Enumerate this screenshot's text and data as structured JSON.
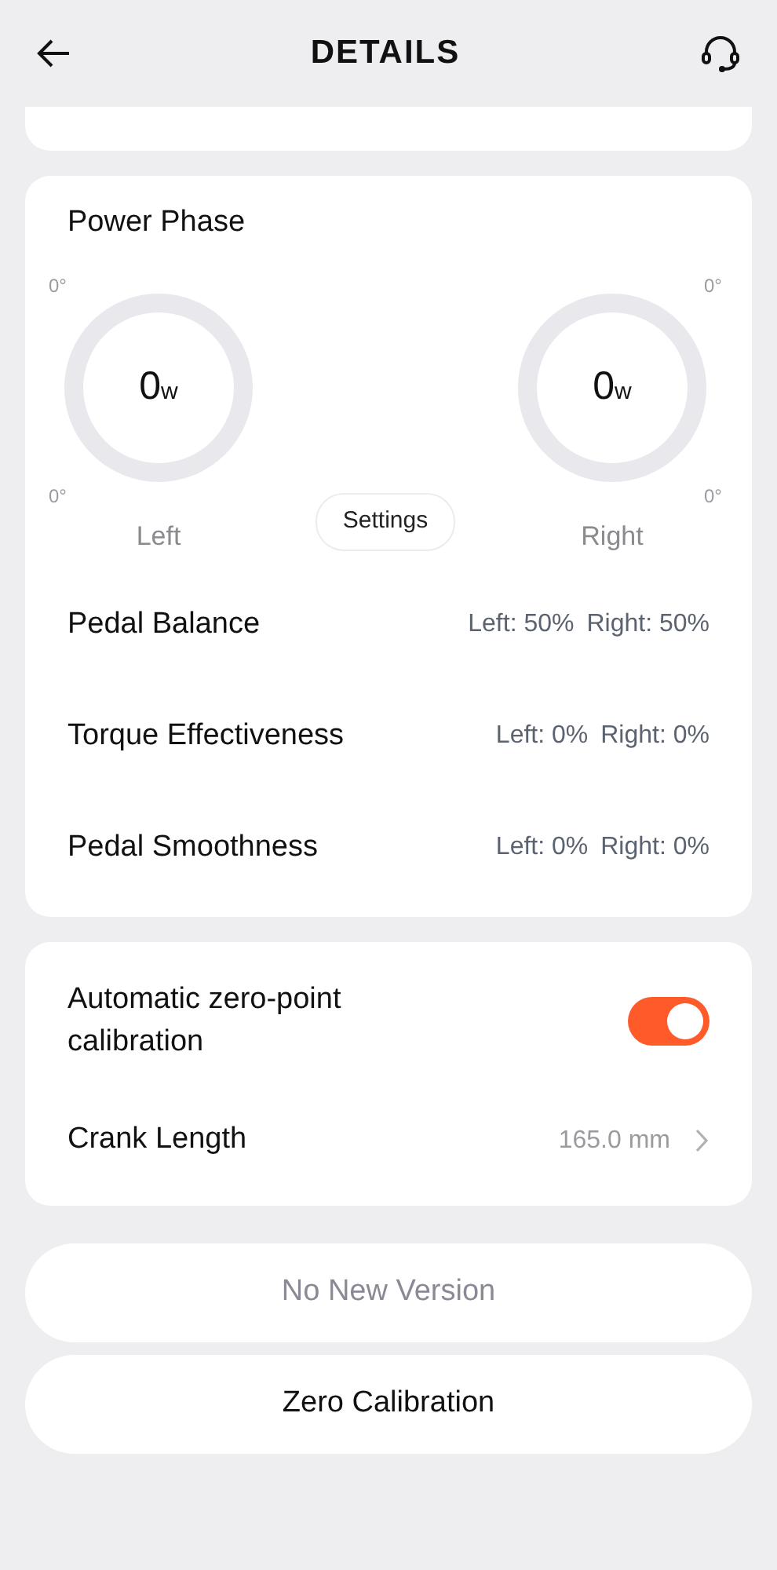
{
  "header": {
    "title": "DETAILS"
  },
  "power_phase": {
    "title": "Power Phase",
    "gauges": [
      {
        "side": "Left",
        "value": "0",
        "unit": "w",
        "top_angle": "0°",
        "bottom_angle": "0°"
      },
      {
        "side": "Right",
        "value": "0",
        "unit": "w",
        "top_angle": "0°",
        "bottom_angle": "0°"
      }
    ],
    "settings_button": "Settings"
  },
  "metrics": [
    {
      "label": "Pedal Balance",
      "left": "Left: 50%",
      "right": "Right: 50%"
    },
    {
      "label": "Torque Effectiveness",
      "left": "Left: 0%",
      "right": "Right: 0%"
    },
    {
      "label": "Pedal Smoothness",
      "left": "Left: 0%",
      "right": "Right: 0%"
    }
  ],
  "settings": [
    {
      "kind": "toggle",
      "label": "Automatic zero-point calibration",
      "on": true
    },
    {
      "kind": "link",
      "label": "Crank Length",
      "value": "165.0 mm"
    }
  ],
  "buttons": [
    {
      "label": "No New Version",
      "disabled": true
    },
    {
      "label": "Zero Calibration",
      "disabled": false
    }
  ]
}
